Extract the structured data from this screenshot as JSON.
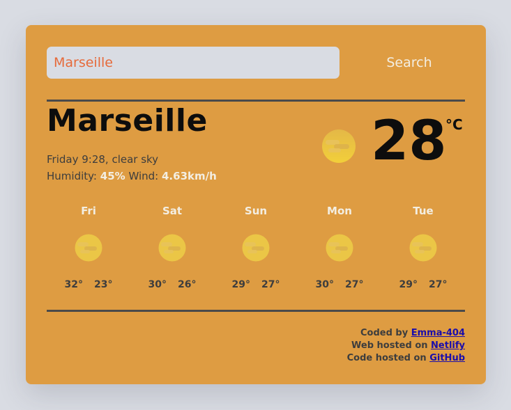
{
  "search": {
    "value": "Marseille",
    "button_label": "Search"
  },
  "current": {
    "city": "Marseille",
    "description": "Friday 9:28, clear sky",
    "humidity_label": "Humidity:",
    "humidity_value": "45%",
    "wind_label": "Wind:",
    "wind_value": "4.63km/h",
    "temperature": "28",
    "unit": "°C",
    "icon": "sun-cloud-icon"
  },
  "forecast": [
    {
      "day": "Fri",
      "max": "32°",
      "min": "23°",
      "icon": "sun-cloud-icon"
    },
    {
      "day": "Sat",
      "max": "30°",
      "min": "26°",
      "icon": "sun-cloud-icon"
    },
    {
      "day": "Sun",
      "max": "29°",
      "min": "27°",
      "icon": "sun-cloud-icon"
    },
    {
      "day": "Mon",
      "max": "30°",
      "min": "27°",
      "icon": "sun-cloud-icon"
    },
    {
      "day": "Tue",
      "max": "29°",
      "min": "27°",
      "icon": "sun-cloud-icon"
    }
  ],
  "credits": {
    "coded_prefix": "Coded by",
    "coded_link": "Emma-404",
    "hosted_prefix": "Web hosted on",
    "hosted_link": "Netlify",
    "code_prefix": "Code hosted on",
    "code_link": "GitHub"
  },
  "colors": {
    "card_background": "#de9c42",
    "page_background": "#d9dce3",
    "input_text": "#e66a3a",
    "highlight": "#f3eee2",
    "link": "#1a0dab"
  }
}
